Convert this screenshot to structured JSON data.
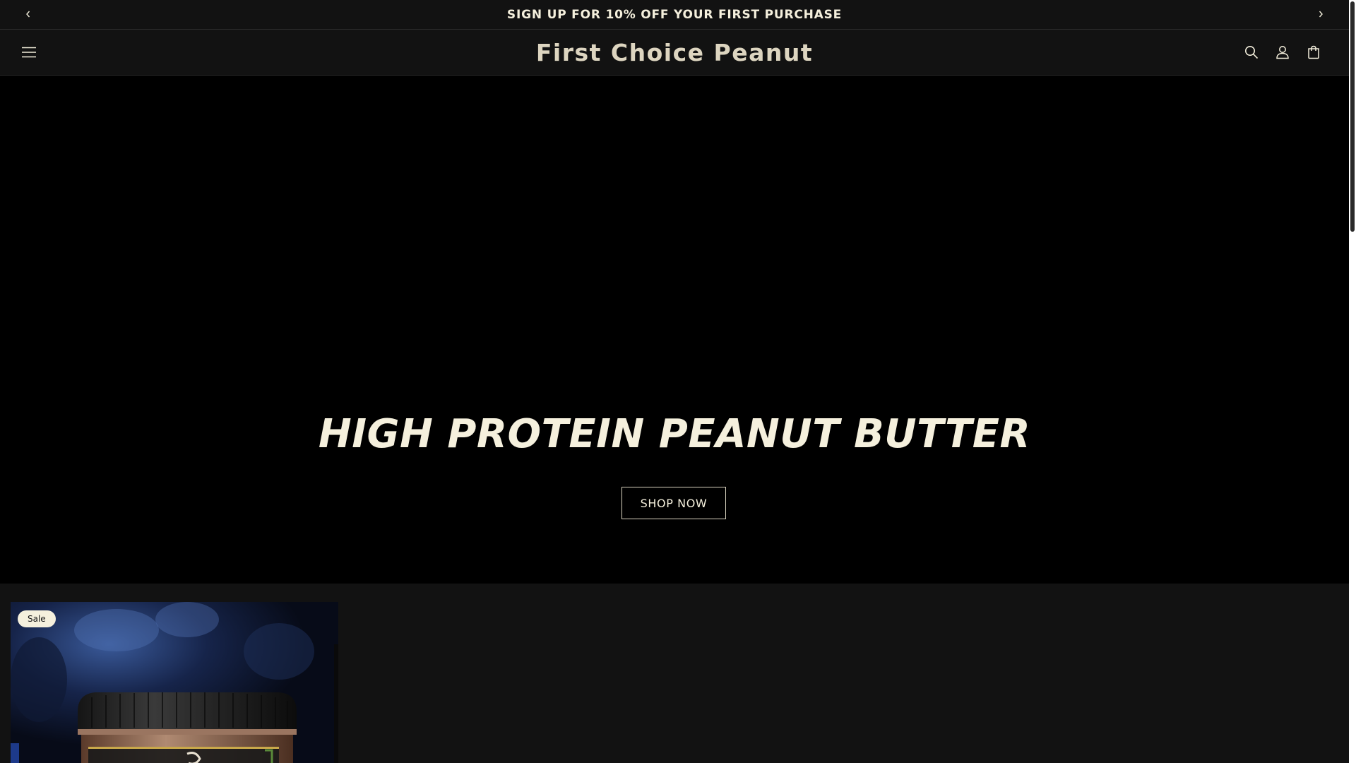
{
  "announcement": {
    "text": "SIGN UP FOR 10% OFF YOUR FIRST PURCHASE",
    "prev_icon": "chevron-left-icon",
    "next_icon": "chevron-right-icon"
  },
  "header": {
    "logo": "First Choice Peanut",
    "menu_icon": "hamburger-menu-icon",
    "search_icon": "search-icon",
    "account_icon": "account-icon",
    "cart_icon": "cart-icon"
  },
  "hero": {
    "heading": "HIGH PROTEIN PEANUT BUTTER",
    "button_label": "SHOP NOW"
  },
  "products": [
    {
      "badge": "Sale"
    }
  ],
  "colors": {
    "background": "#121212",
    "hero_background": "#000000",
    "text": "#f5f0dd",
    "logo": "#ddd5c0"
  }
}
